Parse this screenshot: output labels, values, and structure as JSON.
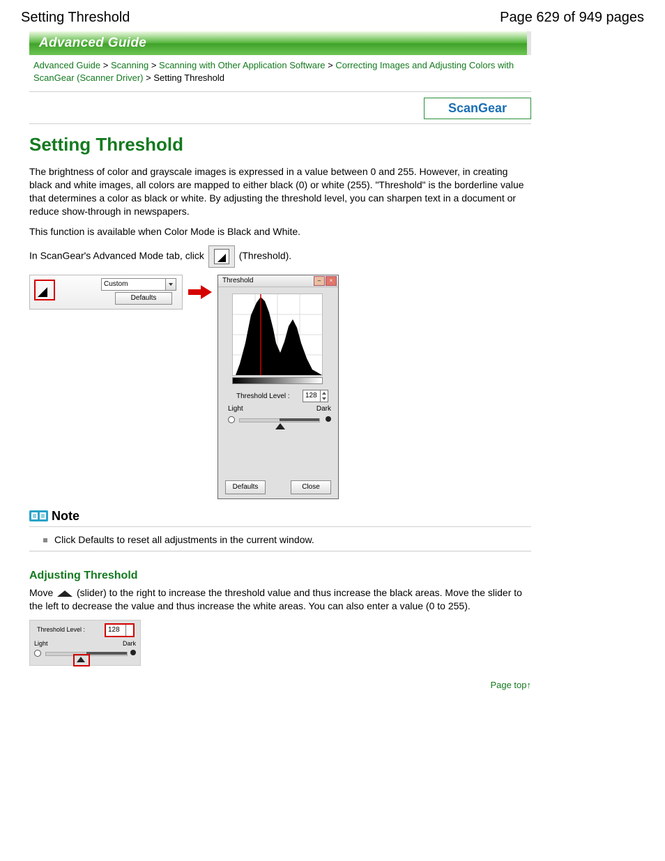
{
  "header": {
    "title_left": "Setting Threshold",
    "title_right": "Page 629 of 949 pages"
  },
  "banner": "Advanced Guide",
  "breadcrumbs": {
    "items": [
      "Advanced Guide",
      "Scanning",
      "Scanning with Other Application Software",
      "Correcting Images and Adjusting Colors with ScanGear (Scanner Driver)"
    ],
    "sep": ">",
    "current": "Setting Threshold"
  },
  "scangear_label": "ScanGear",
  "page_title": "Setting Threshold",
  "paragraphs": {
    "p1": "The brightness of color and grayscale images is expressed in a value between 0 and 255. However, in creating black and white images, all colors are mapped to either black (0) or white (255). \"Threshold\" is the borderline value that determines a color as black or white. By adjusting the threshold level, you can sharpen text in a document or reduce show-through in newspapers.",
    "p2": "This function is available when Color Mode is Black and White.",
    "p3_a": "In ScanGear's Advanced Mode tab, click ",
    "p3_b": " (Threshold)."
  },
  "panel": {
    "dropdown_value": "Custom",
    "defaults_btn": "Defaults"
  },
  "dialog": {
    "title": "Threshold",
    "threshold_label": "Threshold Level :",
    "threshold_value": "128",
    "light": "Light",
    "dark": "Dark",
    "defaults_btn": "Defaults",
    "close_btn": "Close"
  },
  "note": {
    "title": "Note",
    "item": "Click Defaults to reset all adjustments in the current window."
  },
  "subhead": "Adjusting Threshold",
  "p4_a": "Move ",
  "p4_b": " (slider) to the right to increase the threshold value and thus increase the black areas. Move the slider to the left to decrease the value and thus increase the white areas. You can also enter a value (0 to 255).",
  "fig2": {
    "threshold_label": "Threshold Level :",
    "threshold_value": "128",
    "light": "Light",
    "dark": "Dark"
  },
  "pagetop": "Page top"
}
